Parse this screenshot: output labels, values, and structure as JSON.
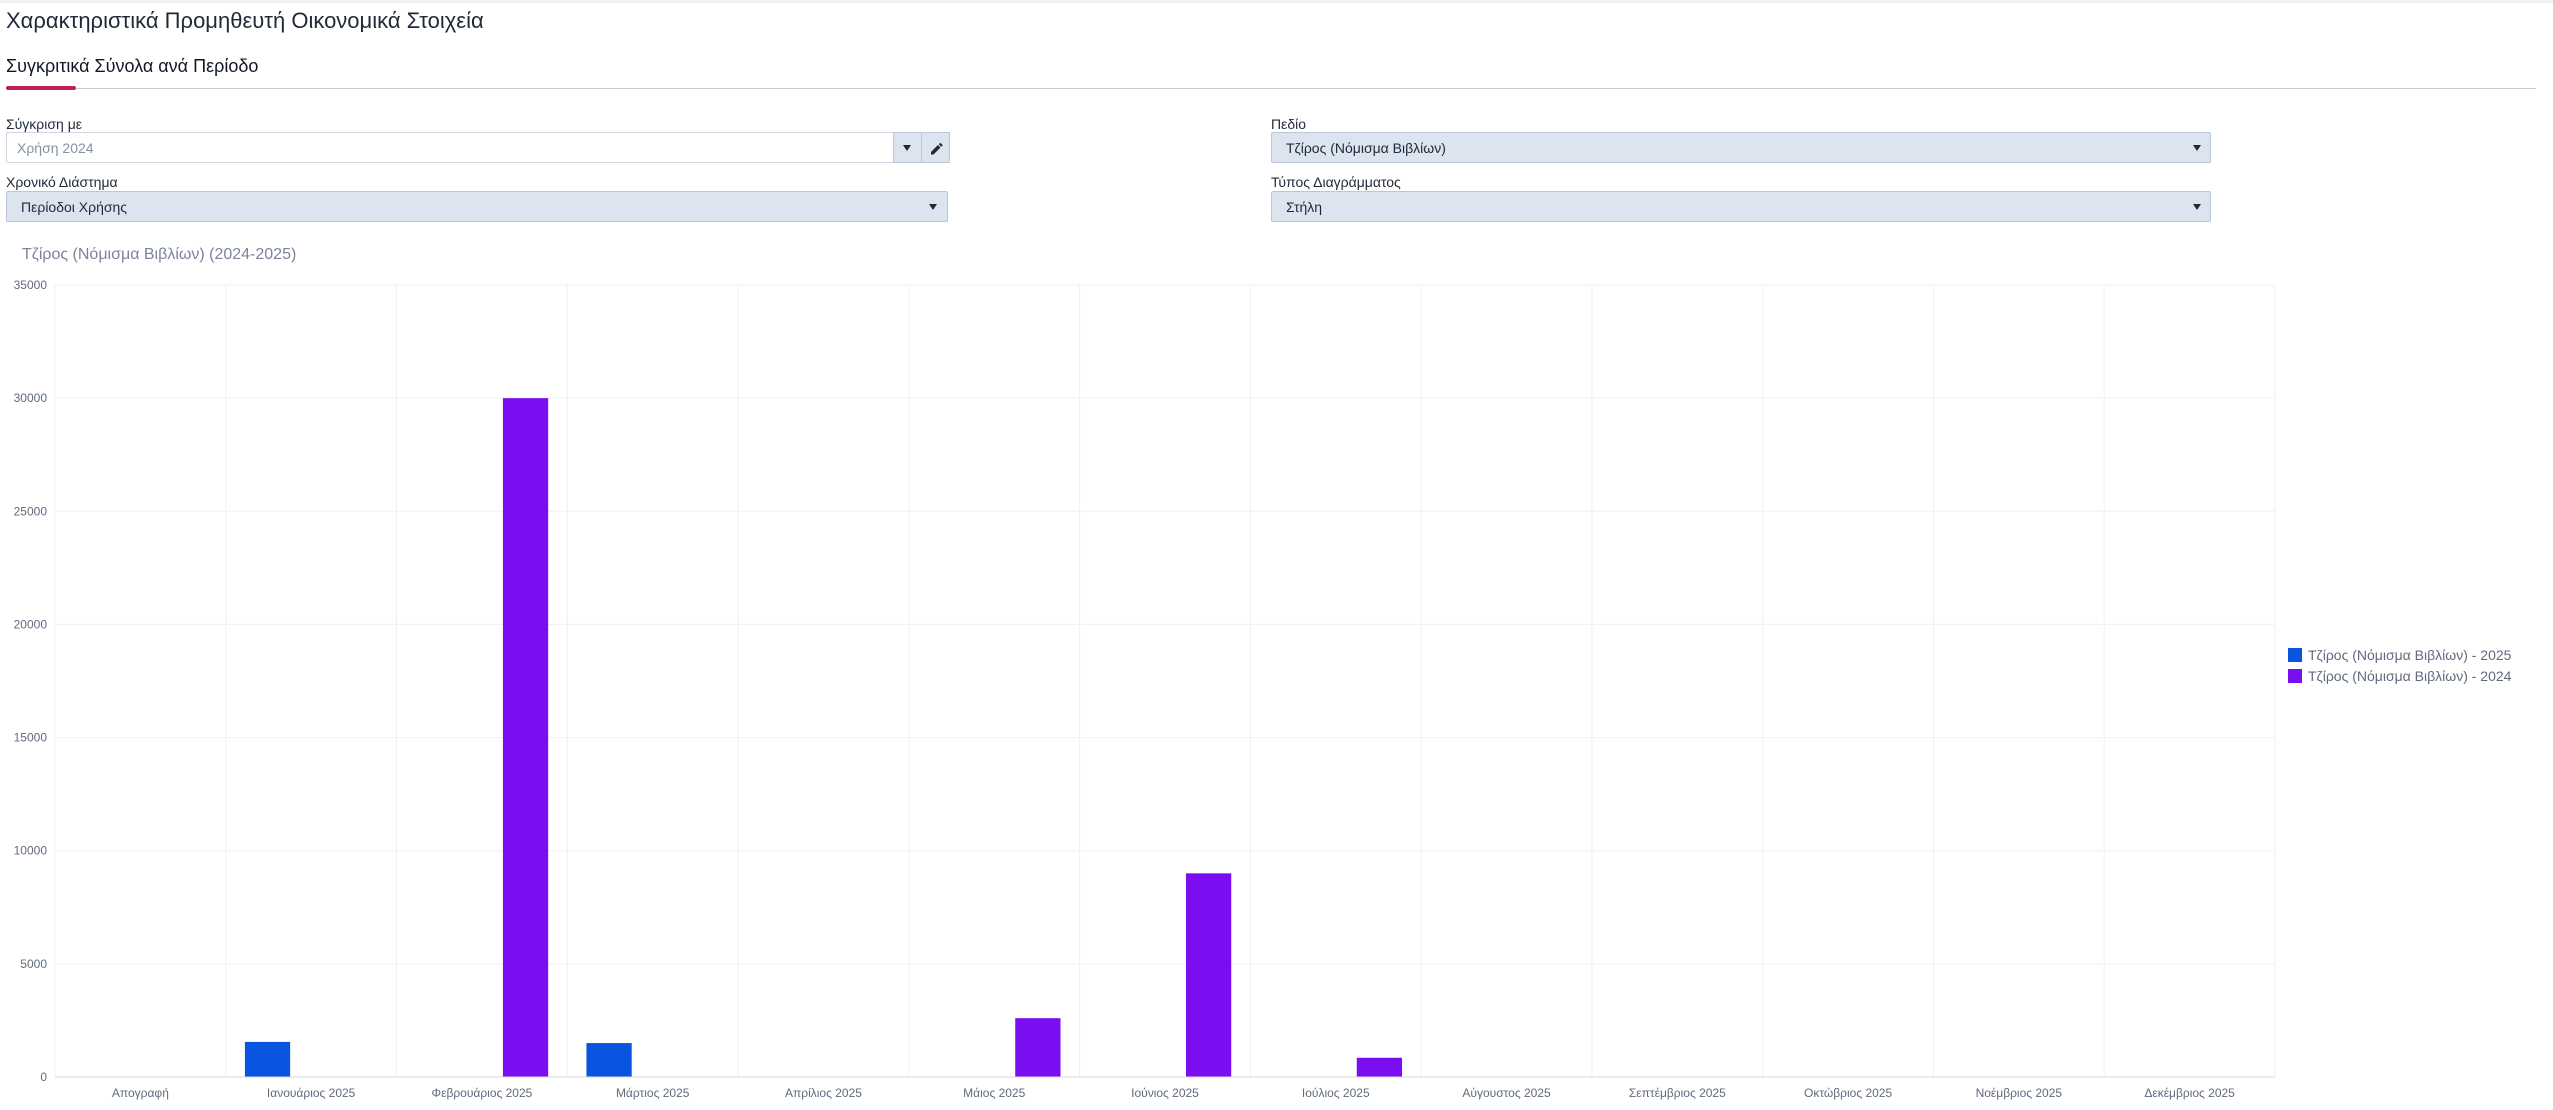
{
  "page": {
    "title": "Χαρακτηριστικά Προμηθευτή Οικονομικά Στοιχεία"
  },
  "tabs": [
    {
      "label": "Συγκριτικά Σύνολα ανά Περίοδο",
      "active": true
    }
  ],
  "filters": {
    "compare_with": {
      "label": "Σύγκριση με",
      "value": "Χρήση 2024"
    },
    "period": {
      "label": "Χρονικό Διάστημα",
      "value": "Περίοδοι Χρήσης"
    },
    "field": {
      "label": "Πεδίο",
      "value": "Τζίρος (Νόμισμα Βιβλίων)"
    },
    "chart_type": {
      "label": "Τύπος Διαγράμματος",
      "value": "Στήλη"
    }
  },
  "colors": {
    "accent": "#c0205a",
    "series_2025": "#0a55e0",
    "series_2024": "#7b0ef0",
    "field_bg": "#dbe4ef"
  },
  "icons": {
    "dropdown": "chevron-down-icon",
    "edit": "pencil-icon"
  },
  "chart_data": {
    "type": "bar",
    "title": "Τζίρος (Νόμισμα Βιβλίων) (2024-2025)",
    "xlabel": "",
    "ylabel": "",
    "ylim": [
      0,
      35000
    ],
    "yticks": [
      0,
      5000,
      10000,
      15000,
      20000,
      25000,
      30000,
      35000
    ],
    "grid": true,
    "legend_position": "right",
    "categories": [
      "Απογραφή",
      "Ιανουάριος 2025",
      "Φεβρουάριος 2025",
      "Μάρτιος 2025",
      "Απρίλιος 2025",
      "Μάιος 2025",
      "Ιούνιος 2025",
      "Ιούλιος 2025",
      "Αύγουστος 2025",
      "Σεπτέμβριος 2025",
      "Οκτώβριος 2025",
      "Νοέμβριος 2025",
      "Δεκέμβριος 2025"
    ],
    "series": [
      {
        "name": "Τζίρος (Νόμισμα Βιβλίων) - 2025",
        "color": "#0a55e0",
        "values": [
          0,
          1550,
          0,
          1500,
          0,
          0,
          0,
          0,
          0,
          0,
          0,
          0,
          0
        ]
      },
      {
        "name": "Τζίρος (Νόμισμα Βιβλίων) - 2024",
        "color": "#7b0ef0",
        "values": [
          0,
          0,
          30000,
          0,
          0,
          2600,
          9000,
          850,
          0,
          0,
          0,
          0,
          0
        ]
      }
    ]
  }
}
